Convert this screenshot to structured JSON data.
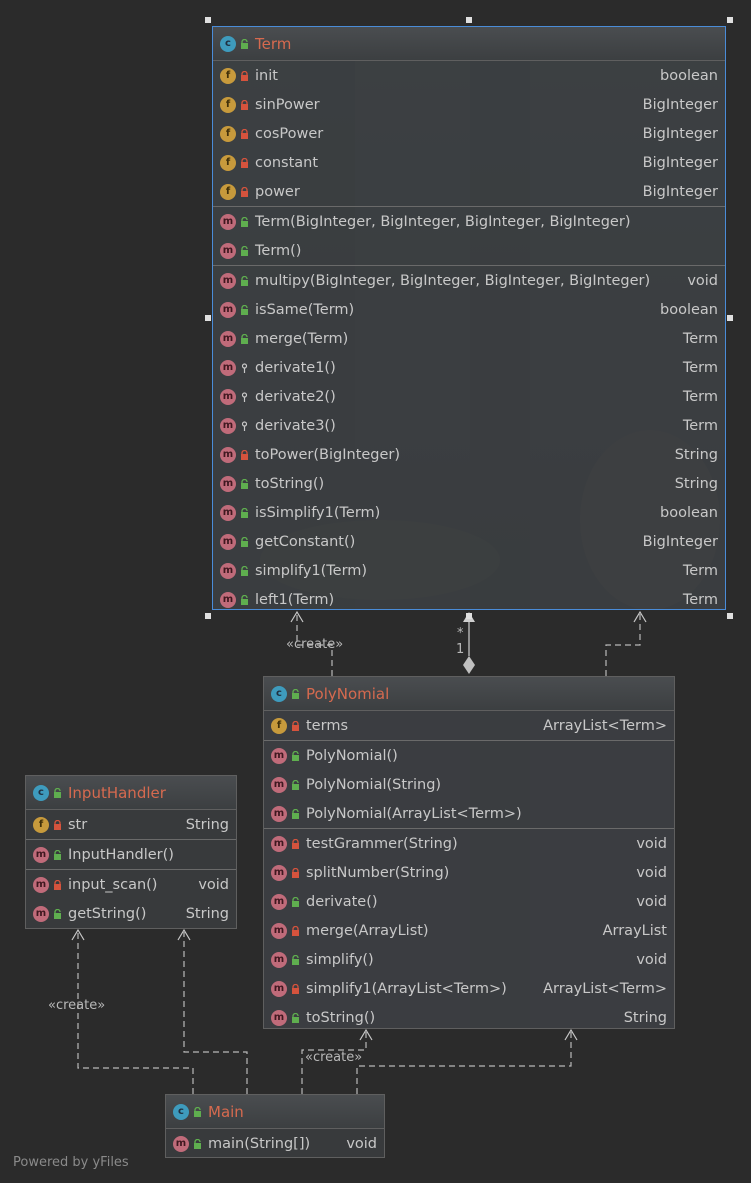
{
  "diagram": {
    "watermark": "Powered by yFiles",
    "labels": {
      "create_term": "«create»",
      "create_input": "«create»",
      "create_poly": "«create»",
      "multiplicity_star": "*",
      "multiplicity_one": "1"
    },
    "classes": {
      "term": {
        "name": "Term",
        "fields": [
          {
            "name": "init",
            "type": "boolean",
            "vis": "private"
          },
          {
            "name": "sinPower",
            "type": "BigInteger",
            "vis": "private"
          },
          {
            "name": "cosPower",
            "type": "BigInteger",
            "vis": "private"
          },
          {
            "name": "constant",
            "type": "BigInteger",
            "vis": "private"
          },
          {
            "name": "power",
            "type": "BigInteger",
            "vis": "private"
          }
        ],
        "constructors": [
          {
            "name": "Term(BigInteger, BigInteger, BigInteger, BigInteger)",
            "type": "",
            "vis": "public"
          },
          {
            "name": "Term()",
            "type": "",
            "vis": "public"
          }
        ],
        "methods": [
          {
            "name": "multipy(BigInteger, BigInteger, BigInteger, BigInteger)",
            "type": "void",
            "vis": "public"
          },
          {
            "name": "isSame(Term)",
            "type": "boolean",
            "vis": "public"
          },
          {
            "name": "merge(Term)",
            "type": "Term",
            "vis": "public"
          },
          {
            "name": "derivate1()",
            "type": "Term",
            "vis": "package"
          },
          {
            "name": "derivate2()",
            "type": "Term",
            "vis": "package"
          },
          {
            "name": "derivate3()",
            "type": "Term",
            "vis": "package"
          },
          {
            "name": "toPower(BigInteger)",
            "type": "String",
            "vis": "private"
          },
          {
            "name": "toString()",
            "type": "String",
            "vis": "public"
          },
          {
            "name": "isSimplify1(Term)",
            "type": "boolean",
            "vis": "public"
          },
          {
            "name": "getConstant()",
            "type": "BigInteger",
            "vis": "public"
          },
          {
            "name": "simplify1(Term)",
            "type": "Term",
            "vis": "public"
          },
          {
            "name": "left1(Term)",
            "type": "Term",
            "vis": "public"
          }
        ]
      },
      "polynomial": {
        "name": "PolyNomial",
        "fields": [
          {
            "name": "terms",
            "type": "ArrayList<Term>",
            "vis": "private"
          }
        ],
        "constructors": [
          {
            "name": "PolyNomial()",
            "type": "",
            "vis": "public"
          },
          {
            "name": "PolyNomial(String)",
            "type": "",
            "vis": "public"
          },
          {
            "name": "PolyNomial(ArrayList<Term>)",
            "type": "",
            "vis": "public"
          }
        ],
        "methods": [
          {
            "name": "testGrammer(String)",
            "type": "void",
            "vis": "private"
          },
          {
            "name": "splitNumber(String)",
            "type": "void",
            "vis": "private"
          },
          {
            "name": "derivate()",
            "type": "void",
            "vis": "public"
          },
          {
            "name": "merge(ArrayList)",
            "type": "ArrayList",
            "vis": "private"
          },
          {
            "name": "simplify()",
            "type": "void",
            "vis": "public"
          },
          {
            "name": "simplify1(ArrayList<Term>)",
            "type": "ArrayList<Term>",
            "vis": "private"
          },
          {
            "name": "toString()",
            "type": "String",
            "vis": "public"
          }
        ]
      },
      "inputhandler": {
        "name": "InputHandler",
        "fields": [
          {
            "name": "str",
            "type": "String",
            "vis": "private"
          }
        ],
        "constructors": [
          {
            "name": "InputHandler()",
            "type": "",
            "vis": "public"
          }
        ],
        "methods": [
          {
            "name": "input_scan()",
            "type": "void",
            "vis": "private"
          },
          {
            "name": "getString()",
            "type": "String",
            "vis": "public"
          }
        ]
      },
      "main": {
        "name": "Main",
        "fields": [],
        "constructors": [],
        "methods": [
          {
            "name": "main(String[])",
            "type": "void",
            "vis": "public"
          }
        ]
      }
    },
    "colors": {
      "class_name": "#d66a4f",
      "selection": "#4a8cd8",
      "badge_class": "#3e9bbd",
      "badge_field": "#c79a3c",
      "badge_method": "#c06b7a",
      "vis_public": "#5fae4f",
      "vis_private": "#d5533d"
    }
  }
}
